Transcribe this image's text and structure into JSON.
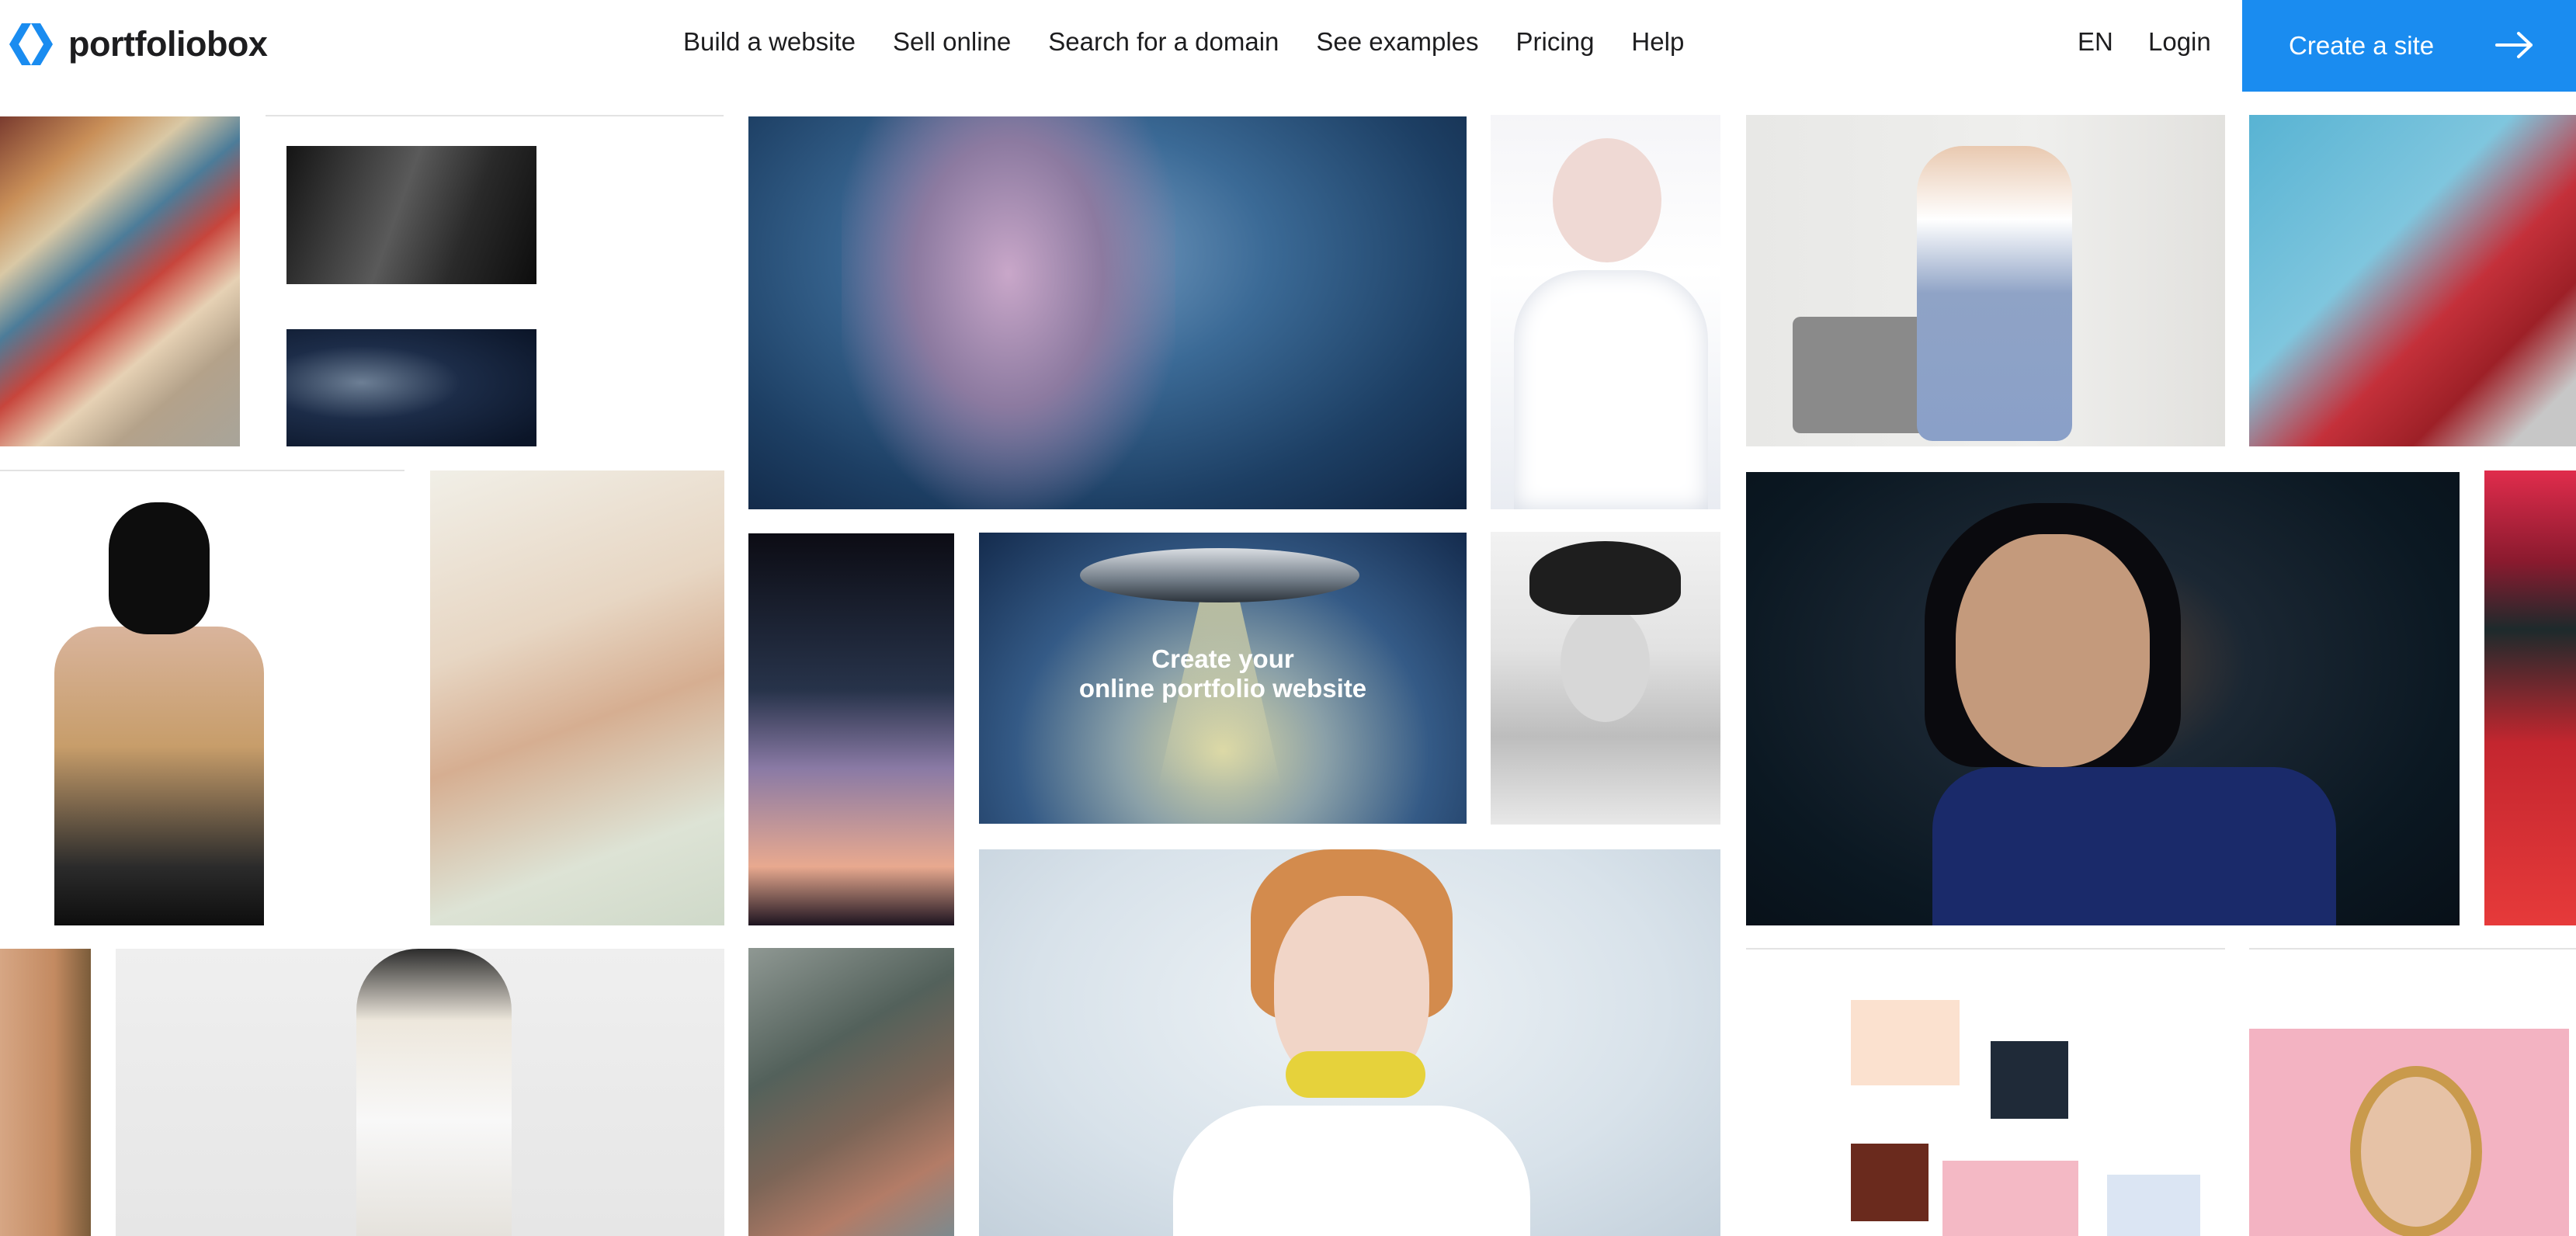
{
  "brand": {
    "name": "portfoliobox",
    "logo_icon": "portfoliobox-logo-icon",
    "accent_color": "#1a8cf0"
  },
  "nav": {
    "items": [
      {
        "label": "Build a website"
      },
      {
        "label": "Sell online"
      },
      {
        "label": "Search for a domain"
      },
      {
        "label": "See examples"
      },
      {
        "label": "Pricing"
      },
      {
        "label": "Help"
      }
    ],
    "language": "EN",
    "login": "Login",
    "cta_label": "Create a site",
    "cta_icon": "arrow-right-icon"
  },
  "hero": {
    "title_line1": "Create your",
    "title_line2": "online portfolio website"
  }
}
